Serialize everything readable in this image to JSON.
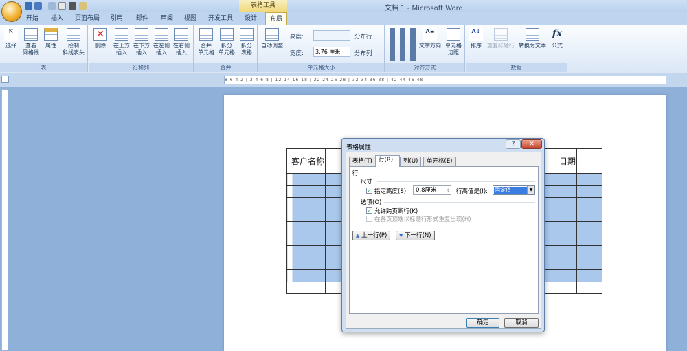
{
  "window": {
    "title": "文档 1 - Microsoft Word",
    "context_tab_group": "表格工具"
  },
  "tabs": [
    "开始",
    "插入",
    "页面布局",
    "引用",
    "邮件",
    "审阅",
    "视图",
    "开发工具",
    "设计",
    "布局"
  ],
  "active_tab": "布局",
  "ribbon": {
    "groups": [
      {
        "label": "表",
        "buttons": [
          "选择",
          "查看\n网格线",
          "属性",
          "绘制\n斜线表头"
        ]
      },
      {
        "label": "行和列",
        "buttons": [
          "删除",
          "在上方\n插入",
          "在下方\n插入",
          "在左侧\n插入",
          "在右侧\n插入"
        ]
      },
      {
        "label": "合并",
        "buttons": [
          "合并\n单元格",
          "拆分\n单元格",
          "拆分\n表格"
        ]
      },
      {
        "label": "单元格大小",
        "autofit": "自动调整",
        "height_label": "高度:",
        "height_value": "",
        "width_label": "宽度:",
        "width_value": "3.76 厘米",
        "distribute_rows": "分布行",
        "distribute_cols": "分布列"
      },
      {
        "label": "对齐方式",
        "text_direction": "文字方向",
        "cell_margins": "单元格\n边距"
      },
      {
        "label": "数据",
        "buttons": [
          "排序",
          "重复标题行",
          "转换为文本",
          "公式"
        ]
      }
    ]
  },
  "ruler": {
    "marks": "8 6 4 2 | 2 4 6 8 | 12 14 16 18 | 22 24 26 28 | 32 34 36 38 | 42 44 46 48"
  },
  "document": {
    "table": {
      "header_left": "客户名称",
      "header_right": "日期",
      "selected_rows": 9
    }
  },
  "dialog": {
    "title": "表格属性",
    "help": "?",
    "close": "✕",
    "tabs": [
      "表格(T)",
      "行(R)",
      "列(U)",
      "单元格(E)"
    ],
    "active_tab": "行(R)",
    "section_row": "行",
    "size_label": "尺寸",
    "specify_height": {
      "label": "指定高度(S):",
      "checked": true,
      "value": "0.8厘米"
    },
    "row_height_is": {
      "label": "行高值是(I):",
      "value": "固定值"
    },
    "options_label": "选项(O)",
    "allow_break": {
      "label": "允许跨页断行(K)",
      "checked": true
    },
    "repeat_header": {
      "label": "在各页顶端以标题行形式重复出现(H)",
      "checked": false
    },
    "prev_row": "上一行(P)",
    "next_row": "下一行(N)",
    "ok": "确定",
    "cancel": "取消"
  }
}
